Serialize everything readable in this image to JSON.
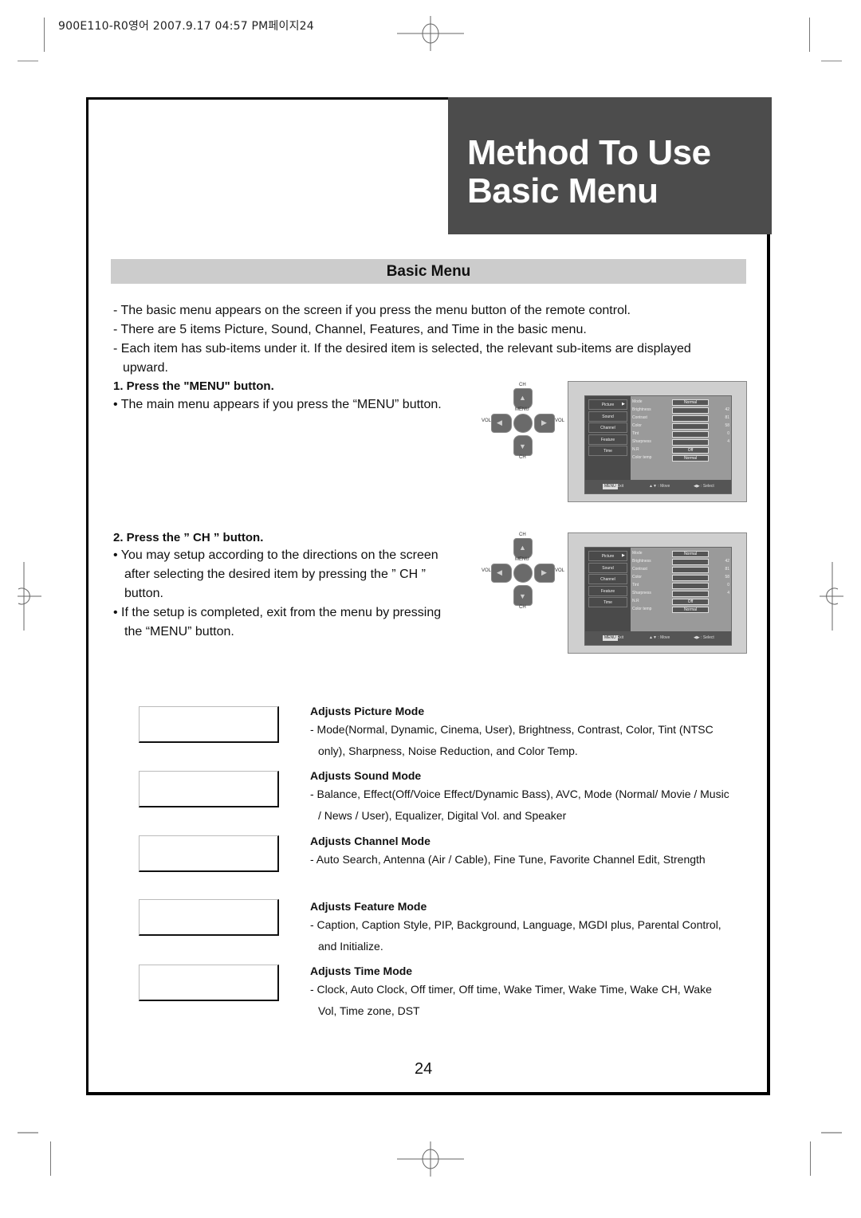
{
  "print_header": "900E110-R0영어  2007.9.17 04:57 PM페이지24",
  "title": {
    "line1": "Method To Use",
    "line2": "Basic Menu"
  },
  "section_title": "Basic Menu",
  "intro": [
    "- The basic menu appears on the screen if you press the menu button of the remote control.",
    "- There are 5 items Picture, Sound, Channel, Features, and Time in the basic menu.",
    "- Each item has sub-items under it. If the desired item is selected, the relevant sub-items are displayed upward."
  ],
  "steps": [
    {
      "title": "1. Press the \"MENU\" button.",
      "bullets": [
        "• The main menu appears if you press the “MENU” button."
      ]
    },
    {
      "title": "2. Press the ”    CH    ” button.",
      "bullets": [
        "• You may setup according to the directions on the screen after selecting the desired item by pressing the ”    CH    ” button.",
        "• If the setup is completed, exit from the menu by pressing the “MENU” button."
      ]
    }
  ],
  "remote": {
    "ch_label": "CH",
    "vol_label": "VOL",
    "menu_label": "MENU",
    "up": "▲",
    "down": "▼",
    "left": "◀",
    "right": "▶"
  },
  "tv_menu": {
    "items": [
      "Picture",
      "Sound",
      "Channel",
      "Feature",
      "Time"
    ],
    "selected_marker": "▶",
    "rows": [
      {
        "label": "Mode",
        "bar": "Normal",
        "value": ""
      },
      {
        "label": "Brightness",
        "bar": "",
        "value": "42"
      },
      {
        "label": "Contrast",
        "bar": "",
        "value": "81"
      },
      {
        "label": "Color",
        "bar": "",
        "value": "58"
      },
      {
        "label": "Tint",
        "bar": "",
        "value": "0"
      },
      {
        "label": "Sharpness",
        "bar": "",
        "value": "4"
      },
      {
        "label": "N.R",
        "bar": "Off",
        "value": ""
      },
      {
        "label": "Color temp",
        "bar": "Normal",
        "value": ""
      }
    ],
    "footer": {
      "menu_key": "MENU",
      "exit": ": Exit",
      "move": "▲▼ : Move",
      "select": "◀▶ : Select"
    }
  },
  "sub_items": [
    {
      "heading": "Adjusts Picture Mode",
      "text": "- Mode(Normal, Dynamic, Cinema, User), Brightness, Contrast, Color, Tint (NTSC only), Sharpness, Noise Reduction, and Color Temp."
    },
    {
      "heading": "Adjusts Sound Mode",
      "text": "- Balance, Effect(Off/Voice Effect/Dynamic Bass), AVC, Mode (Normal/ Movie / Music / News / User), Equalizer, Digital Vol. and Speaker"
    },
    {
      "heading": "Adjusts Channel Mode",
      "text": "- Auto Search, Antenna (Air / Cable), Fine Tune, Favorite Channel Edit, Strength"
    },
    {
      "heading": "Adjusts Feature Mode",
      "text": "- Caption, Caption Style, PIP, Background, Language, MGDI plus, Parental Control, and Initialize."
    },
    {
      "heading": "Adjusts Time Mode",
      "text": "- Clock, Auto Clock, Off timer, Off time, Wake Timer, Wake Time, Wake CH, Wake Vol, Time zone, DST"
    }
  ],
  "page_number": "24"
}
